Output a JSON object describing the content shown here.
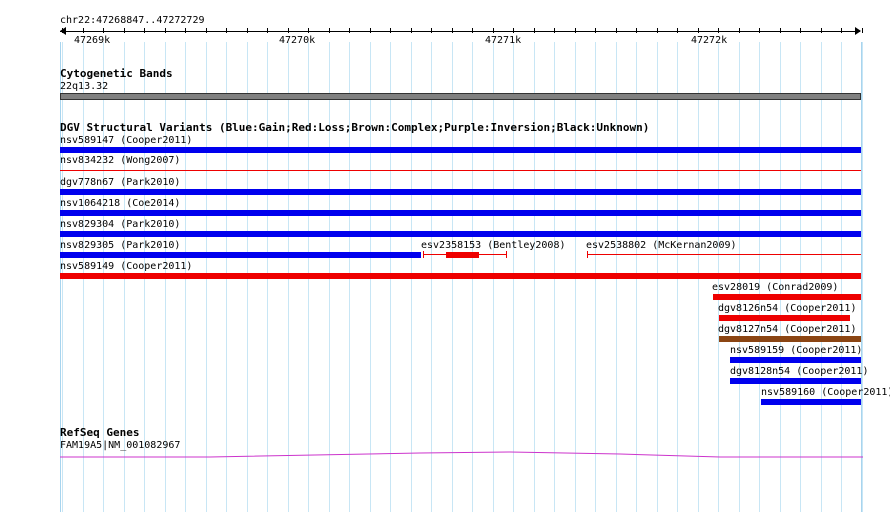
{
  "ruler": {
    "locus": "chr22:47268847..47272729",
    "labels": [
      "47269k",
      "47270k",
      "47271k",
      "47272k"
    ]
  },
  "cytoband": {
    "title": "Cytogenetic Bands",
    "band": "22q13.32"
  },
  "dgv": {
    "title": "DGV Structural Variants (Blue:Gain;Red:Loss;Brown:Complex;Purple:Inversion;Black:Unknown)",
    "items": [
      {
        "label": "nsv589147 (Cooper2011)",
        "color": "#0000ee"
      },
      {
        "label": "nsv834232 (Wong2007)",
        "color": "#ee0000"
      },
      {
        "label": "dgv778n67 (Park2010)",
        "color": "#0000ee"
      },
      {
        "label": "nsv1064218 (Coe2014)",
        "color": "#0000ee"
      },
      {
        "label": "nsv829304 (Park2010)",
        "color": "#0000ee"
      },
      {
        "label": "nsv829305 (Park2010)",
        "color": "#0000ee"
      },
      {
        "label": "esv2358153 (Bentley2008)",
        "color": "#ee0000"
      },
      {
        "label": "esv2538802 (McKernan2009)",
        "color": "#ee0000"
      },
      {
        "label": "nsv589149 (Cooper2011)",
        "color": "#ee0000"
      },
      {
        "label": "esv28019 (Conrad2009)",
        "color": "#ee0000"
      },
      {
        "label": "dgv8126n54 (Cooper2011)",
        "color": "#ee0000"
      },
      {
        "label": "dgv8127n54 (Cooper2011)",
        "color": "#8b4513"
      },
      {
        "label": "nsv589159 (Cooper2011)",
        "color": "#0000ee"
      },
      {
        "label": "dgv8128n54 (Cooper2011)",
        "color": "#0000ee"
      },
      {
        "label": "nsv589160 (Cooper2011)",
        "color": "#0000ee"
      }
    ]
  },
  "refseq": {
    "title": "RefSeq Genes",
    "gene": "FAM19A5|NM_001082967",
    "color": "#cc33cc"
  }
}
